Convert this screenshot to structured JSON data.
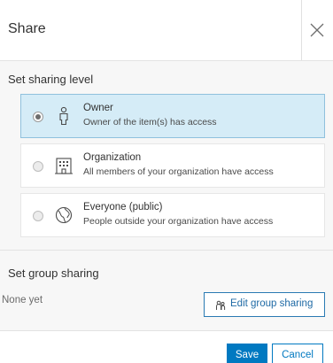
{
  "dialog": {
    "title": "Share",
    "close_icon": "close-icon"
  },
  "sharing_level": {
    "heading": "Set sharing level",
    "options": [
      {
        "title": "Owner",
        "description": "Owner of the item(s) has access",
        "icon": "person-icon",
        "selected": true
      },
      {
        "title": "Organization",
        "description": "All members of your organization have access",
        "icon": "organization-icon",
        "selected": false
      },
      {
        "title": "Everyone (public)",
        "description": "People outside your organization have access",
        "icon": "globe-icon",
        "selected": false
      }
    ]
  },
  "group_sharing": {
    "heading": "Set group sharing",
    "status": "None yet",
    "edit_button_label": "Edit group sharing",
    "edit_icon": "group-icon"
  },
  "footer": {
    "save_label": "Save",
    "cancel_label": "Cancel"
  },
  "colors": {
    "accent": "#0079c1",
    "selected_bg": "#d5ecf7",
    "body_bg": "#f7f7f7"
  }
}
